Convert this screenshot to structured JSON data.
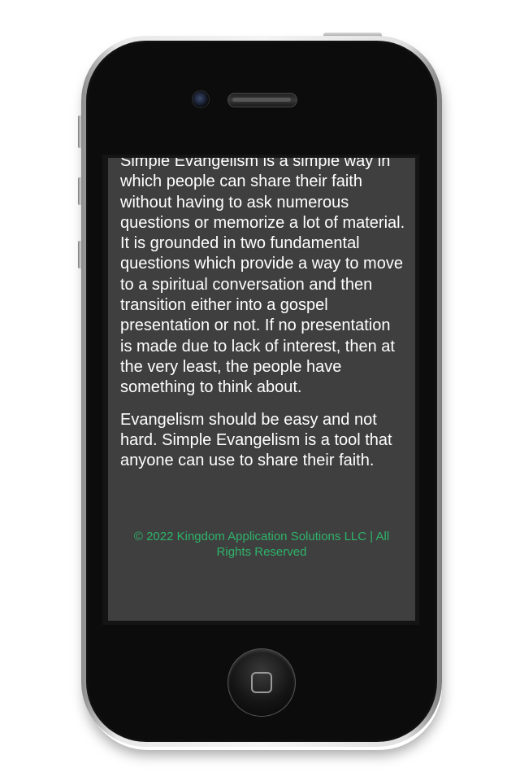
{
  "device": {
    "model": "iPhone 4",
    "frame_color": "#0c0c0c",
    "bezel_color": "#e8e8e8"
  },
  "screen": {
    "background": "#3f3f3f",
    "paragraphs": [
      "Simple Evangelism is a simple way in which people can share their faith without having to ask numerous questions or memorize a lot of material. It is grounded in two fundamental questions which provide a way to move to a spiritual conversation and then transition either into a gospel presentation or not. If no presentation is made due to lack of interest, then at the very least, the people have something to think about.",
      "Evangelism should be easy and not hard. Simple Evangelism is a tool that anyone can use to share their faith."
    ],
    "footer": "© 2022 Kingdom Application Solutions LLC | All Rights Reserved",
    "footer_color": "#2fb36a",
    "text_color": "#ffffff"
  }
}
